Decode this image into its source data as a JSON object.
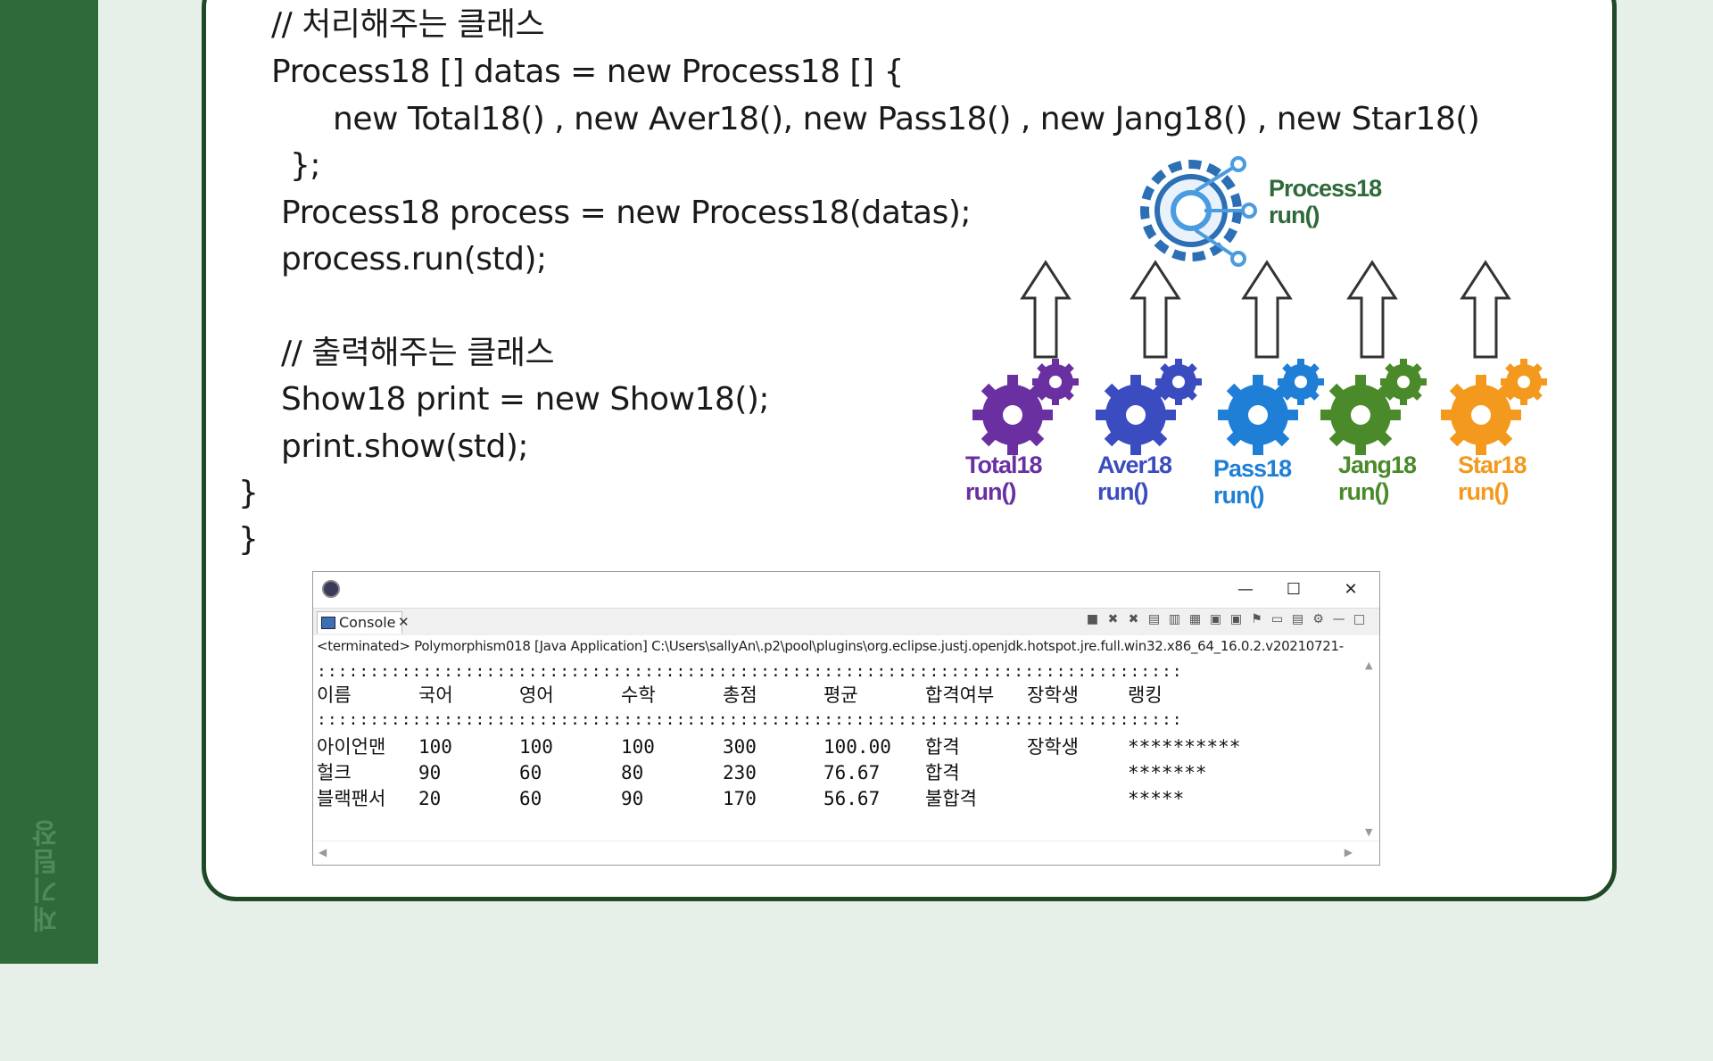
{
  "side_label": "재기팀장",
  "code_lines": [
    "// 처리해주는 클래스",
    "Process18 [] datas = new Process18 [] {",
    "new Total18() , new Aver18(), new Pass18() , new Jang18() , new Star18()",
    "};",
    "Process18 process = new Process18(datas);",
    "process.run(std);",
    "// 출력해주는 클래스",
    "Show18 print = new Show18();",
    "print.show(std);",
    "}",
    "}"
  ],
  "diagram": {
    "parent": {
      "name": "Process18",
      "method": "run()",
      "color": "#2f6b3a"
    },
    "children": [
      {
        "name": "Total18",
        "method": "run()",
        "color": "#6a2fa0"
      },
      {
        "name": "Aver18",
        "method": "run()",
        "color": "#3b4cc0"
      },
      {
        "name": "Pass18",
        "method": "run()",
        "color": "#1f7fd6"
      },
      {
        "name": "Jang18",
        "method": "run()",
        "color": "#4a8a2a"
      },
      {
        "name": "Star18",
        "method": "run()",
        "color": "#f39a1e"
      }
    ]
  },
  "console": {
    "tab_label": "Console",
    "path": "<terminated> Polymorphism018 [Java Application] C:\\Users\\sallyAn\\.p2\\pool\\plugins\\org.eclipse.justj.openjdk.hotspot.jre.full.win32.x86_64_16.0.2.v20210721-",
    "separator": "::::::::::::::::::::::::::::::::::::::::::::::::::::::::::::::::::::::::::::::::::",
    "headers": [
      "이름",
      "국어",
      "영어",
      "수학",
      "총점",
      "평균",
      "합격여부",
      "장학생",
      "랭킹"
    ],
    "rows": [
      [
        "아이언맨",
        "100",
        "100",
        "100",
        "300",
        "100.00",
        "합격",
        "장학생",
        "**********"
      ],
      [
        "헐크",
        "90",
        "60",
        "80",
        "230",
        "76.67",
        "합격",
        "",
        "*******"
      ],
      [
        "블랙팬서",
        "20",
        "60",
        "90",
        "170",
        "56.67",
        "불합격",
        "",
        "*****"
      ]
    ]
  }
}
